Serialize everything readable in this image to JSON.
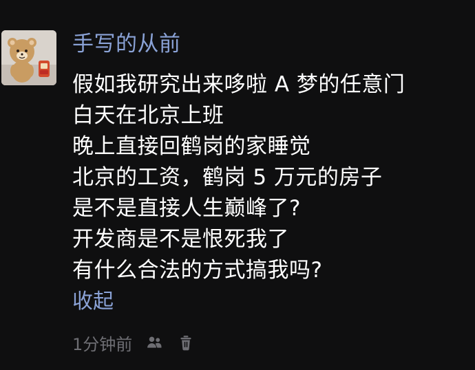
{
  "post": {
    "username": "手写的从前",
    "lines": [
      "假如我研究出来哆啦 A 梦的任意门",
      "白天在北京上班",
      "晚上直接回鹤岗的家睡觉",
      "北京的工资，鹤岗 5 万元的房子",
      "是不是直接人生巅峰了?",
      "开发商是不是恨死我了",
      "有什么合法的方式搞我吗?"
    ],
    "collapse_label": "收起",
    "time_label": "1分钟前"
  },
  "icons": {
    "avatar": "avatar-bear-icon",
    "mention": "users-icon",
    "delete": "trash-icon"
  },
  "colors": {
    "background": "#0f0f10",
    "username": "#8aa2d6",
    "text": "#ffffff",
    "meta": "#6e6e73"
  }
}
